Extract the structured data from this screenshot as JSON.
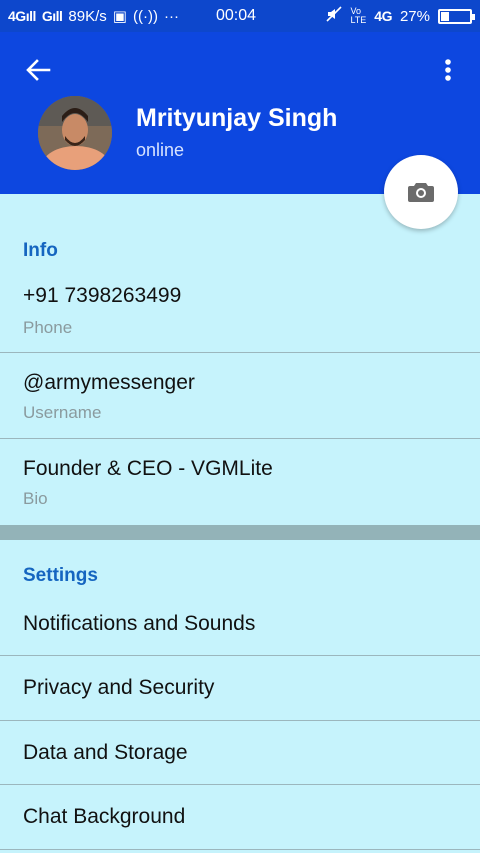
{
  "status_bar": {
    "network1": "4G",
    "network2": "G",
    "speed": "89K/s",
    "time": "00:04",
    "lte_label": "4G",
    "battery_text": "27%",
    "battery_level": 0.27
  },
  "header": {
    "name": "Mrityunjay Singh",
    "presence": "online"
  },
  "info": {
    "title": "Info",
    "phone_value": "+91 7398263499",
    "phone_label": "Phone",
    "username_value": "@armymessenger",
    "username_label": "Username",
    "bio_value": "Founder & CEO - VGMLite",
    "bio_label": "Bio"
  },
  "settings": {
    "title": "Settings",
    "items": [
      {
        "label": "Notifications and Sounds"
      },
      {
        "label": "Privacy and Security"
      },
      {
        "label": "Data and Storage"
      },
      {
        "label": "Chat Background"
      }
    ]
  },
  "colors": {
    "header_bg": "#0d47e0",
    "page_bg": "#c6f3fc",
    "section_title": "#1565c0"
  }
}
